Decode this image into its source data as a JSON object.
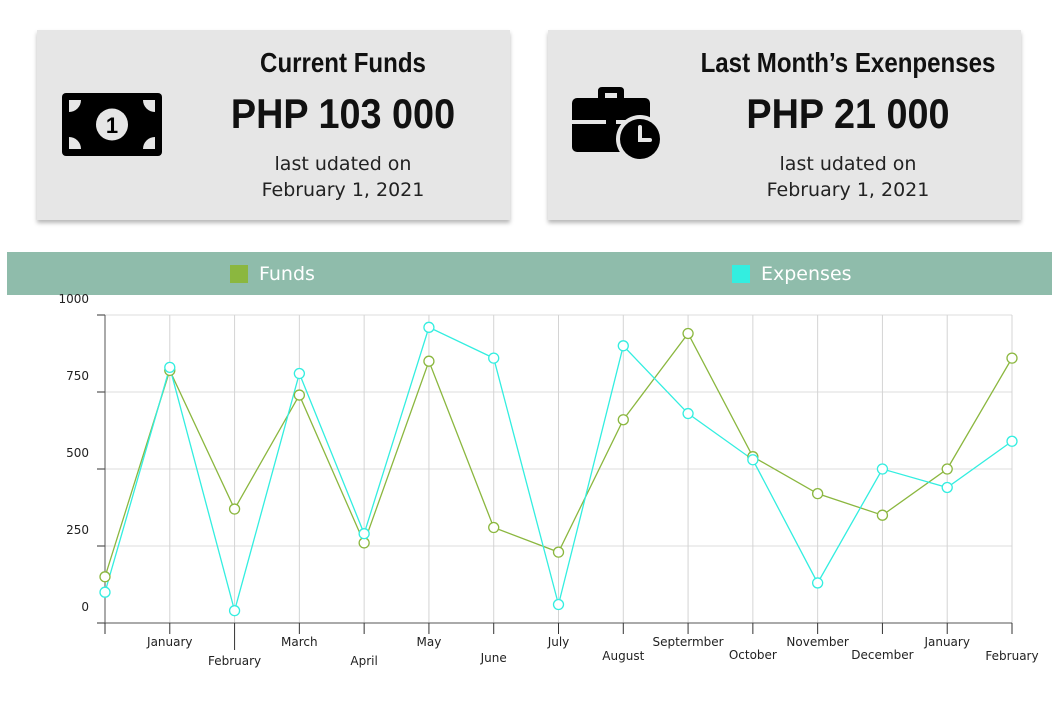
{
  "cards": [
    {
      "title": "Current Funds",
      "value": "PHP 103 000",
      "subtitle_line1": "last udated on",
      "subtitle_line2": "February 1, 2021",
      "icon": "banknote-icon"
    },
    {
      "title": "Last Month’s Exenpenses",
      "value": "PHP 21 000",
      "subtitle_line1": "last udated on",
      "subtitle_line2": "February 1, 2021",
      "icon": "briefcase-clock-icon"
    }
  ],
  "legend": [
    {
      "label": "Funds",
      "color": "#8bb73f"
    },
    {
      "label": "Expenses",
      "color": "#33eee0"
    }
  ],
  "chart_data": {
    "type": "line",
    "x": [
      "",
      "January",
      "February",
      "March",
      "April",
      "May",
      "June",
      "July",
      "August",
      "Septermber",
      "October",
      "November",
      "December",
      "January",
      "February"
    ],
    "ylim": [
      0,
      1000
    ],
    "yticks": [
      0,
      250,
      500,
      750,
      1000
    ],
    "ytick_labels": [
      "0",
      "250",
      "500",
      "750",
      "1000"
    ],
    "grid": true,
    "legend_position": "top",
    "series": [
      {
        "name": "Funds",
        "color": "#8bb73f",
        "values": [
          150,
          820,
          370,
          740,
          260,
          850,
          310,
          230,
          660,
          940,
          540,
          420,
          350,
          500,
          860
        ]
      },
      {
        "name": "Expenses",
        "color": "#33eee0",
        "values": [
          100,
          830,
          40,
          810,
          290,
          960,
          860,
          60,
          900,
          680,
          530,
          130,
          500,
          440,
          590
        ]
      }
    ]
  }
}
